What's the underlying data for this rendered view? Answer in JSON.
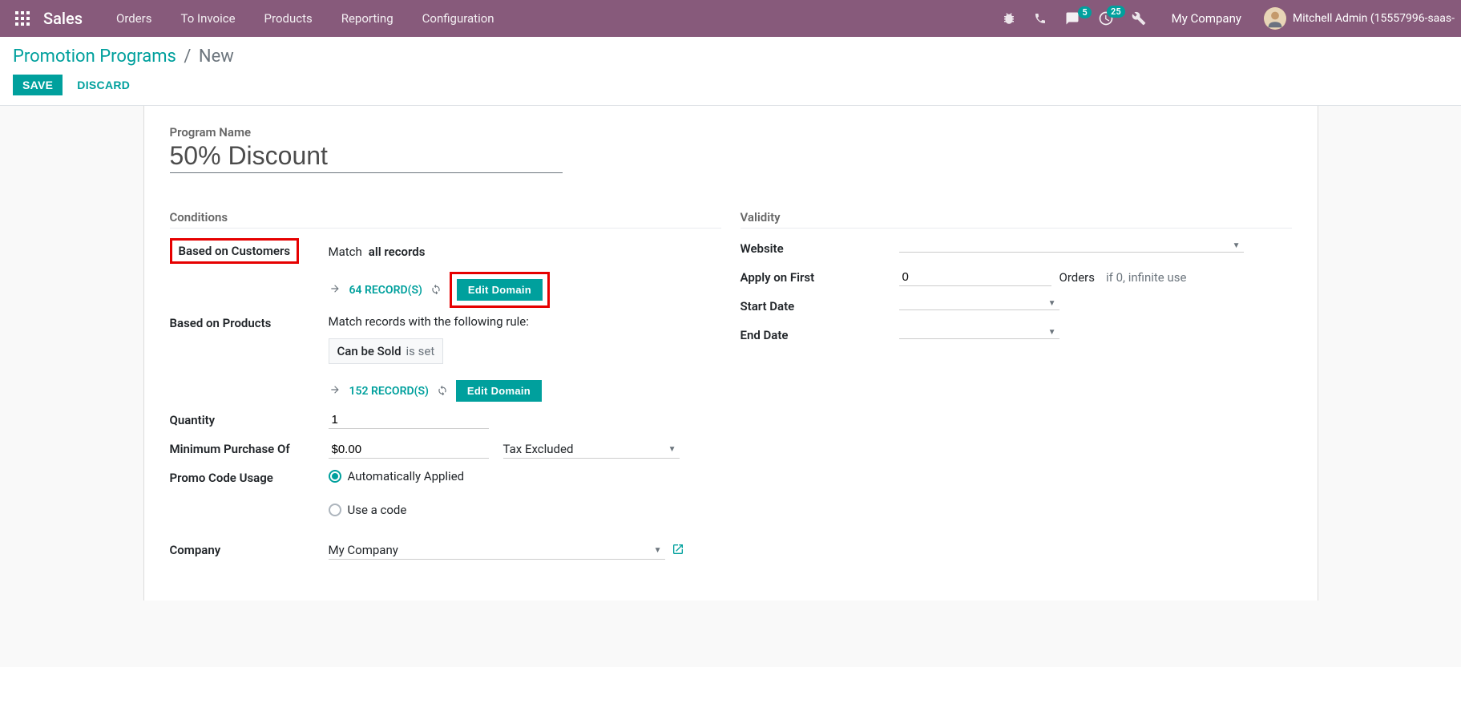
{
  "navbar": {
    "brand": "Sales",
    "menu": [
      "Orders",
      "To Invoice",
      "Products",
      "Reporting",
      "Configuration"
    ],
    "conversations_badge": "5",
    "activities_badge": "25",
    "company": "My Company",
    "user": "Mitchell Admin (15557996-saas-"
  },
  "breadcrumb": {
    "root": "Promotion Programs",
    "current": "New"
  },
  "buttons": {
    "save": "Save",
    "discard": "Discard",
    "edit_domain": "Edit Domain"
  },
  "form": {
    "program_name_label": "Program Name",
    "program_name_value": "50% Discount",
    "conditions_title": "Conditions",
    "validity_title": "Validity",
    "based_customers_label": "Based on Customers",
    "match_all": "Match",
    "match_all_bold": "all records",
    "records_64": "64 RECORD(S)",
    "based_products_label": "Based on Products",
    "match_rule_text": "Match records with the following rule:",
    "rule_field": "Can be Sold",
    "rule_value": "is set",
    "records_152": "152 RECORD(S)",
    "quantity_label": "Quantity",
    "quantity_value": "1",
    "min_purchase_label": "Minimum Purchase Of",
    "min_purchase_value": "$0.00",
    "tax_select": "Tax Excluded",
    "promo_code_label": "Promo Code Usage",
    "promo_auto": "Automatically Applied",
    "promo_code": "Use a code",
    "company_label": "Company",
    "company_value": "My Company",
    "website_label": "Website",
    "apply_first_label": "Apply on First",
    "apply_first_value": "0",
    "apply_first_unit": "Orders",
    "apply_first_hint": "if 0, infinite use",
    "start_date_label": "Start Date",
    "end_date_label": "End Date"
  }
}
